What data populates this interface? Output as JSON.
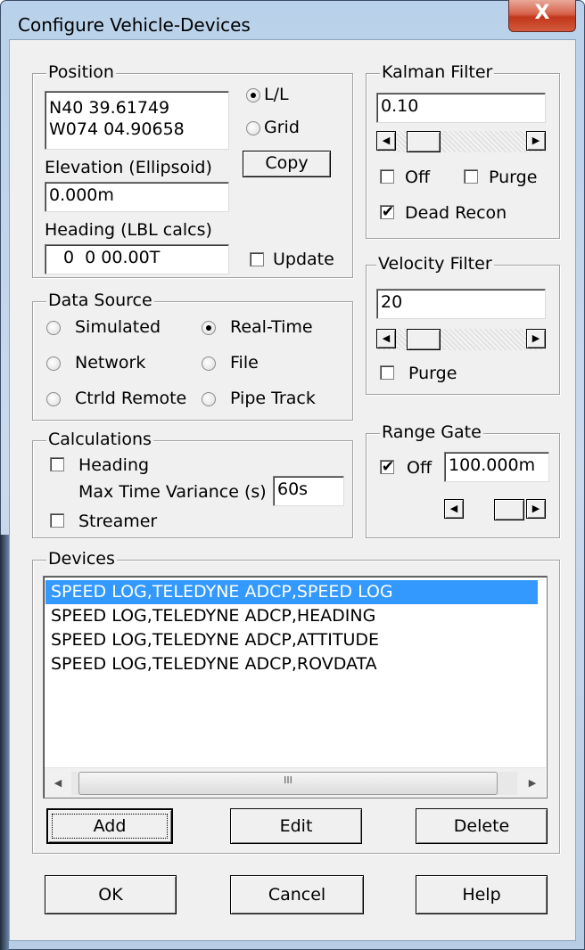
{
  "window": {
    "title": "Configure Vehicle-Devices",
    "close_glyph": "X"
  },
  "position": {
    "label": "Position",
    "coords_line1": "N40 39.61749",
    "coords_line2": "W074 04.90658",
    "mode_ll": "L/L",
    "mode_grid": "Grid",
    "selected_mode": "L/L",
    "copy_label": "Copy",
    "elevation_label": "Elevation (Ellipsoid)",
    "elevation_value": "0.000m",
    "heading_label": "Heading (LBL calcs)",
    "heading_value": "0  0 00.00T",
    "update_label": "Update",
    "update_checked": false
  },
  "kalman": {
    "label": "Kalman Filter",
    "value": "0.10",
    "slider_fraction": 0.1,
    "off_label": "Off",
    "off_checked": false,
    "purge_label": "Purge",
    "purge_checked": false,
    "dead_recon_label": "Dead Recon",
    "dead_recon_checked": true
  },
  "velocity": {
    "label": "Velocity Filter",
    "value": "20",
    "slider_fraction": 0.1,
    "purge_label": "Purge",
    "purge_checked": false
  },
  "data_source": {
    "label": "Data Source",
    "options": [
      "Simulated",
      "Real-Time",
      "Network",
      "File",
      "Ctrld Remote",
      "Pipe Track"
    ],
    "selected": "Real-Time"
  },
  "calculations": {
    "label": "Calculations",
    "heading_label": "Heading",
    "heading_checked": false,
    "variance_label": "Max Time Variance (s)",
    "variance_value": "60s",
    "streamer_label": "Streamer",
    "streamer_checked": false
  },
  "range_gate": {
    "label": "Range Gate",
    "off_label": "Off",
    "off_checked": true,
    "value": "100.000m"
  },
  "devices": {
    "label": "Devices",
    "items": [
      "SPEED LOG,TELEDYNE ADCP,SPEED LOG",
      "SPEED LOG,TELEDYNE ADCP,HEADING",
      "SPEED LOG,TELEDYNE ADCP,ATTITUDE",
      "SPEED LOG,TELEDYNE ADCP,ROVDATA"
    ],
    "selected_index": 0,
    "thumb_grip": "III",
    "add_label": "Add",
    "edit_label": "Edit",
    "delete_label": "Delete"
  },
  "footer": {
    "ok_label": "OK",
    "cancel_label": "Cancel",
    "help_label": "Help"
  },
  "colors": {
    "selection": "#3399ff",
    "dialog_bg": "#f0f0f0",
    "close_button": "#c1371c",
    "frame": "#c9daec"
  }
}
